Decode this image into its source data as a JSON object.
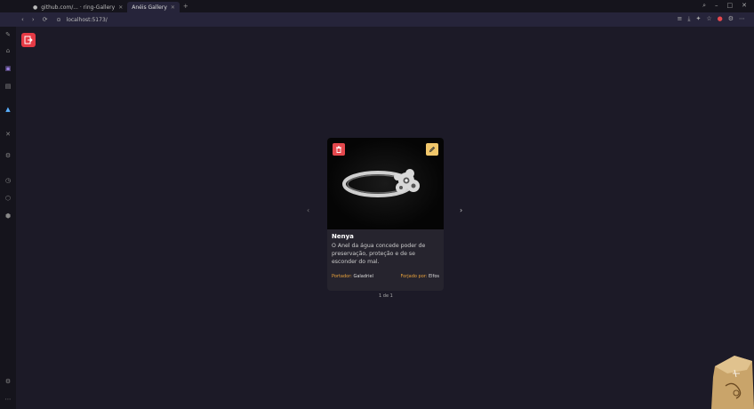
{
  "browser": {
    "tabs": [
      {
        "label": "github.com/... · ring-Gallery"
      },
      {
        "label": "Anéis Gallery"
      }
    ],
    "url": "localhost:5173/",
    "nav": {
      "back": "‹",
      "forward": "›",
      "reload": "⟳"
    }
  },
  "card": {
    "title": "Nenya",
    "description": "O Anel da água concede poder de preservação, proteção e de se esconder do mal.",
    "bearer_label": "Portador:",
    "bearer_value": "Galadriel",
    "forged_label": "Forjado por:",
    "forged_value": "Elfos"
  },
  "pager": {
    "text": "1 de 1"
  },
  "arrows": {
    "left": "‹",
    "right": "›"
  },
  "colors": {
    "accent_red": "#e5484d",
    "accent_yellow": "#f1c76b",
    "label_orange": "#e9a23b",
    "background": "#1c1a27"
  }
}
